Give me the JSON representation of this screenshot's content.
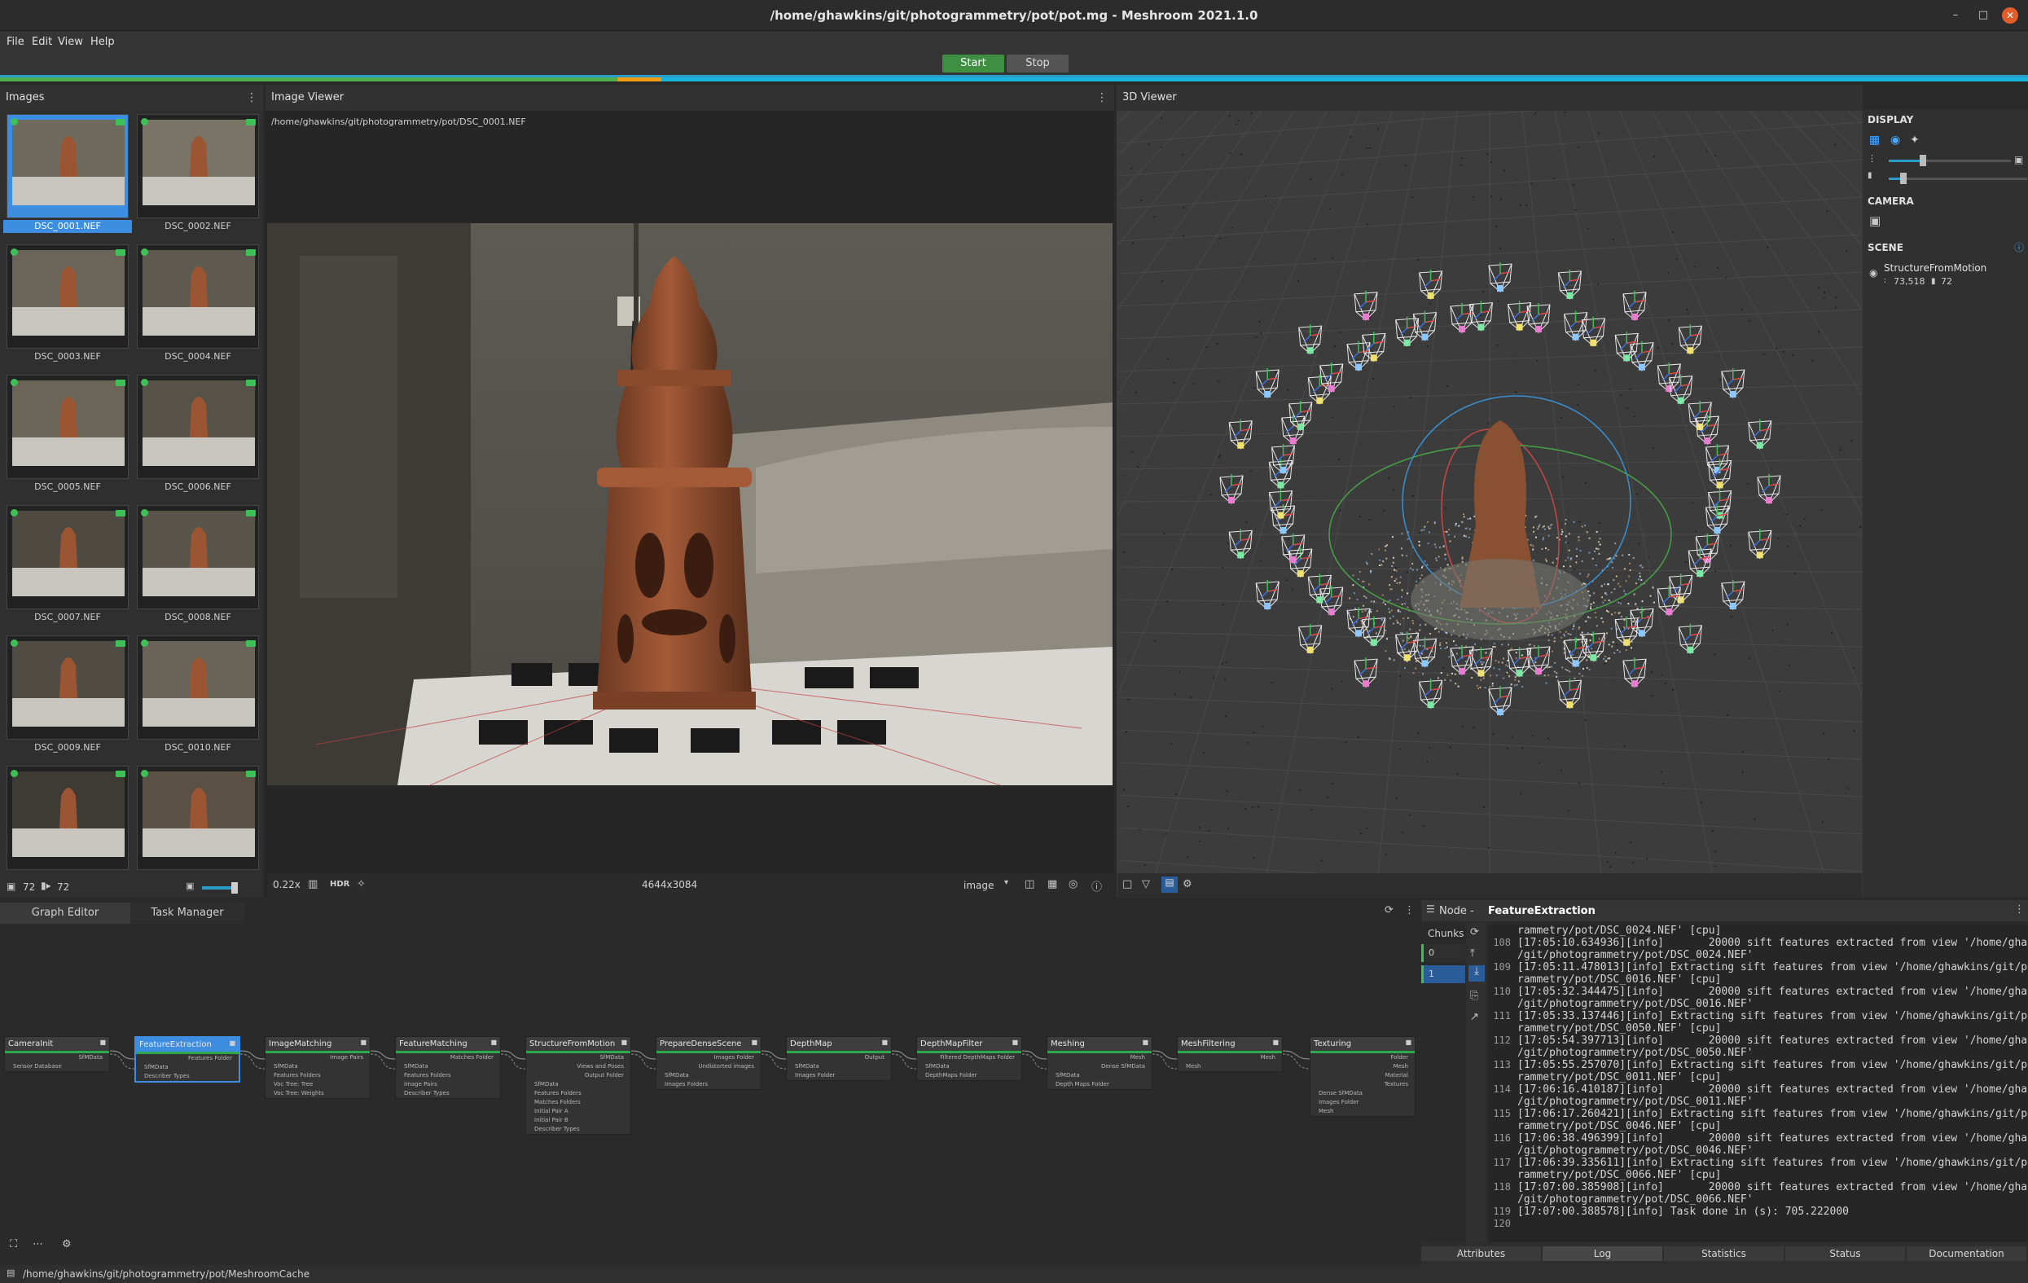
{
  "window": {
    "title": "/home/ghawkins/git/photogrammetry/pot/pot.mg - Meshroom 2021.1.0",
    "minimize_icon": "minimize-icon",
    "maximize_icon": "maximize-icon",
    "close_icon": "close-icon"
  },
  "menu": {
    "file": "File",
    "edit": "Edit",
    "view": "View",
    "help": "Help"
  },
  "toolbar": {
    "start_label": "Start",
    "stop_label": "Stop"
  },
  "progress": {
    "green_fraction": 0.304,
    "orange_fraction": 0.022,
    "colors": {
      "done": "#4caf50",
      "running": "#f39c12",
      "pending": "#18b4dc"
    }
  },
  "images_panel": {
    "title": "Images",
    "thumbnails": [
      {
        "label": "DSC_0001.NEF",
        "selected": true
      },
      {
        "label": "DSC_0002.NEF",
        "selected": false
      },
      {
        "label": "DSC_0003.NEF",
        "selected": false
      },
      {
        "label": "DSC_0004.NEF",
        "selected": false
      },
      {
        "label": "DSC_0005.NEF",
        "selected": false
      },
      {
        "label": "DSC_0006.NEF",
        "selected": false
      },
      {
        "label": "DSC_0007.NEF",
        "selected": false
      },
      {
        "label": "DSC_0008.NEF",
        "selected": false
      },
      {
        "label": "DSC_0009.NEF",
        "selected": false
      },
      {
        "label": "DSC_0010.NEF",
        "selected": false
      },
      {
        "label": "",
        "selected": false
      },
      {
        "label": "",
        "selected": false
      }
    ],
    "image_count": "72",
    "camera_count": "72",
    "thumbnail_size_fraction": 0.75
  },
  "image_viewer": {
    "title": "Image Viewer",
    "path": "/home/ghawkins/git/photogrammetry/pot/DSC_0001.NEF",
    "zoom": "0.22x",
    "hdr": "HDR",
    "resolution": "4644x3084",
    "channel": "image"
  },
  "viewer_3d": {
    "title": "3D Viewer",
    "display_label": "DISPLAY",
    "camera_label": "CAMERA",
    "scene_label": "SCENE",
    "scene_item": "StructureFromMotion",
    "point_count": "73,518",
    "camera_count": "72",
    "point_size_fraction": 0.27,
    "camera_scale_fraction": 0.1
  },
  "bottom_tabs": {
    "graph_editor": "Graph Editor",
    "task_manager": "Task Manager"
  },
  "graph_nodes": [
    {
      "title": "CameraInit",
      "outputs": [
        "SfMData"
      ],
      "inputs": [
        "Sensor Database"
      ]
    },
    {
      "title": "FeatureExtraction",
      "outputs": [
        "Features Folder"
      ],
      "inputs": [
        "SfMData",
        "Describer Types"
      ]
    },
    {
      "title": "ImageMatching",
      "outputs": [
        "Image Pairs"
      ],
      "inputs": [
        "SfMData",
        "Features Folders",
        "Voc Tree: Tree",
        "Voc Tree: Weights"
      ]
    },
    {
      "title": "FeatureMatching",
      "outputs": [
        "Matches Folder"
      ],
      "inputs": [
        "SfMData",
        "Features Folders",
        "Image Pairs",
        "Describer Types"
      ]
    },
    {
      "title": "StructureFromMotion",
      "outputs": [
        "SfMData",
        "Views and Poses",
        "Output Folder"
      ],
      "inputs": [
        "SfMData",
        "Features Folders",
        "Matches Folders",
        "Initial Pair A",
        "Initial Pair B",
        "Describer Types"
      ]
    },
    {
      "title": "PrepareDenseScene",
      "outputs": [
        "Images Folder",
        "Undistorted images"
      ],
      "inputs": [
        "SfMData",
        "Images Folders"
      ]
    },
    {
      "title": "DepthMap",
      "outputs": [
        "Output"
      ],
      "inputs": [
        "SfMData",
        "Images Folder"
      ]
    },
    {
      "title": "DepthMapFilter",
      "outputs": [
        "Filtered DepthMaps Folder"
      ],
      "inputs": [
        "SfMData",
        "DepthMaps Folder"
      ]
    },
    {
      "title": "Meshing",
      "outputs": [
        "Mesh",
        "Dense SfMData"
      ],
      "inputs": [
        "SfMData",
        "Depth Maps Folder"
      ]
    },
    {
      "title": "MeshFiltering",
      "outputs": [
        "Mesh"
      ],
      "inputs": [
        "Mesh"
      ]
    },
    {
      "title": "Texturing",
      "outputs": [
        "Folder",
        "Mesh",
        "Material",
        "Textures"
      ],
      "inputs": [
        "Dense SfMData",
        "Images Folder",
        "Mesh"
      ]
    }
  ],
  "node_panel": {
    "prefix": "Node - ",
    "name": "FeatureExtraction",
    "chunks_label": "Chunks",
    "chunks": [
      "0",
      "1"
    ],
    "log_lines": [
      {
        "num": "",
        "text": "rammetry/pot/DSC_0024.NEF' [cpu]"
      },
      {
        "num": "108",
        "text": "[17:05:10.634936][info]       20000 sift features extracted from view '/home/ghawkins"
      },
      {
        "num": "",
        "text": "/git/photogrammetry/pot/DSC_0024.NEF'"
      },
      {
        "num": "109",
        "text": "[17:05:11.478013][info] Extracting sift features from view '/home/ghawkins/git/photog"
      },
      {
        "num": "",
        "text": "rammetry/pot/DSC_0016.NEF' [cpu]"
      },
      {
        "num": "110",
        "text": "[17:05:32.344475][info]       20000 sift features extracted from view '/home/ghawkins"
      },
      {
        "num": "",
        "text": "/git/photogrammetry/pot/DSC_0016.NEF'"
      },
      {
        "num": "111",
        "text": "[17:05:33.137446][info] Extracting sift features from view '/home/ghawkins/git/photog"
      },
      {
        "num": "",
        "text": "rammetry/pot/DSC_0050.NEF' [cpu]"
      },
      {
        "num": "112",
        "text": "[17:05:54.397713][info]       20000 sift features extracted from view '/home/ghawkins"
      },
      {
        "num": "",
        "text": "/git/photogrammetry/pot/DSC_0050.NEF'"
      },
      {
        "num": "113",
        "text": "[17:05:55.257070][info] Extracting sift features from view '/home/ghawkins/git/photog"
      },
      {
        "num": "",
        "text": "rammetry/pot/DSC_0011.NEF' [cpu]"
      },
      {
        "num": "114",
        "text": "[17:06:16.410187][info]       20000 sift features extracted from view '/home/ghawkins"
      },
      {
        "num": "",
        "text": "/git/photogrammetry/pot/DSC_0011.NEF'"
      },
      {
        "num": "115",
        "text": "[17:06:17.260421][info] Extracting sift features from view '/home/ghawkins/git/photog"
      },
      {
        "num": "",
        "text": "rammetry/pot/DSC_0046.NEF' [cpu]"
      },
      {
        "num": "116",
        "text": "[17:06:38.496399][info]       20000 sift features extracted from view '/home/ghawkins"
      },
      {
        "num": "",
        "text": "/git/photogrammetry/pot/DSC_0046.NEF'"
      },
      {
        "num": "117",
        "text": "[17:06:39.335611][info] Extracting sift features from view '/home/ghawkins/git/photog"
      },
      {
        "num": "",
        "text": "rammetry/pot/DSC_0066.NEF' [cpu]"
      },
      {
        "num": "118",
        "text": "[17:07:00.385908][info]       20000 sift features extracted from view '/home/ghawkins"
      },
      {
        "num": "",
        "text": "/git/photogrammetry/pot/DSC_0066.NEF'"
      },
      {
        "num": "119",
        "text": "[17:07:00.388578][info] Task done in (s): 705.222000"
      },
      {
        "num": "120",
        "text": ""
      }
    ],
    "tabs": [
      "Attributes",
      "Log",
      "Statistics",
      "Status",
      "Documentation"
    ]
  },
  "status_bar": {
    "cache_path": "/home/ghawkins/git/photogrammetry/pot/MeshroomCache"
  }
}
